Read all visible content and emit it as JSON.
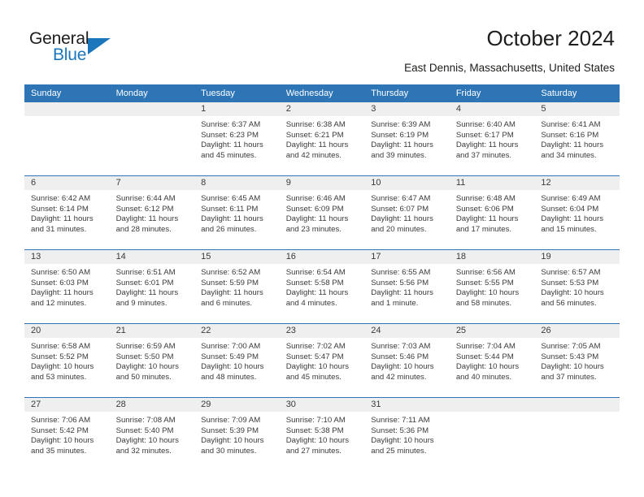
{
  "brand": {
    "name_part1": "General",
    "name_part2": "Blue",
    "icon": "triangle-logo-icon",
    "accent_color": "#1b76bc"
  },
  "header": {
    "title": "October 2024",
    "location": "East Dennis, Massachusetts, United States"
  },
  "colors": {
    "header_row_bg": "#2e75b6",
    "daynum_band_bg": "#efefef",
    "text": "#3a3a3a",
    "row_divider": "#2e75b6"
  },
  "calendar": {
    "weekday_headers": [
      "Sunday",
      "Monday",
      "Tuesday",
      "Wednesday",
      "Thursday",
      "Friday",
      "Saturday"
    ],
    "labels": {
      "sunrise_prefix": "Sunrise:",
      "sunset_prefix": "Sunset:",
      "daylight_prefix": "Daylight:"
    },
    "weeks": [
      [
        {
          "empty": true
        },
        {
          "empty": true
        },
        {
          "day": "1",
          "sunrise": "Sunrise: 6:37 AM",
          "sunset": "Sunset: 6:23 PM",
          "daylight_line1": "Daylight: 11 hours",
          "daylight_line2": "and 45 minutes."
        },
        {
          "day": "2",
          "sunrise": "Sunrise: 6:38 AM",
          "sunset": "Sunset: 6:21 PM",
          "daylight_line1": "Daylight: 11 hours",
          "daylight_line2": "and 42 minutes."
        },
        {
          "day": "3",
          "sunrise": "Sunrise: 6:39 AM",
          "sunset": "Sunset: 6:19 PM",
          "daylight_line1": "Daylight: 11 hours",
          "daylight_line2": "and 39 minutes."
        },
        {
          "day": "4",
          "sunrise": "Sunrise: 6:40 AM",
          "sunset": "Sunset: 6:17 PM",
          "daylight_line1": "Daylight: 11 hours",
          "daylight_line2": "and 37 minutes."
        },
        {
          "day": "5",
          "sunrise": "Sunrise: 6:41 AM",
          "sunset": "Sunset: 6:16 PM",
          "daylight_line1": "Daylight: 11 hours",
          "daylight_line2": "and 34 minutes."
        }
      ],
      [
        {
          "day": "6",
          "sunrise": "Sunrise: 6:42 AM",
          "sunset": "Sunset: 6:14 PM",
          "daylight_line1": "Daylight: 11 hours",
          "daylight_line2": "and 31 minutes."
        },
        {
          "day": "7",
          "sunrise": "Sunrise: 6:44 AM",
          "sunset": "Sunset: 6:12 PM",
          "daylight_line1": "Daylight: 11 hours",
          "daylight_line2": "and 28 minutes."
        },
        {
          "day": "8",
          "sunrise": "Sunrise: 6:45 AM",
          "sunset": "Sunset: 6:11 PM",
          "daylight_line1": "Daylight: 11 hours",
          "daylight_line2": "and 26 minutes."
        },
        {
          "day": "9",
          "sunrise": "Sunrise: 6:46 AM",
          "sunset": "Sunset: 6:09 PM",
          "daylight_line1": "Daylight: 11 hours",
          "daylight_line2": "and 23 minutes."
        },
        {
          "day": "10",
          "sunrise": "Sunrise: 6:47 AM",
          "sunset": "Sunset: 6:07 PM",
          "daylight_line1": "Daylight: 11 hours",
          "daylight_line2": "and 20 minutes."
        },
        {
          "day": "11",
          "sunrise": "Sunrise: 6:48 AM",
          "sunset": "Sunset: 6:06 PM",
          "daylight_line1": "Daylight: 11 hours",
          "daylight_line2": "and 17 minutes."
        },
        {
          "day": "12",
          "sunrise": "Sunrise: 6:49 AM",
          "sunset": "Sunset: 6:04 PM",
          "daylight_line1": "Daylight: 11 hours",
          "daylight_line2": "and 15 minutes."
        }
      ],
      [
        {
          "day": "13",
          "sunrise": "Sunrise: 6:50 AM",
          "sunset": "Sunset: 6:03 PM",
          "daylight_line1": "Daylight: 11 hours",
          "daylight_line2": "and 12 minutes."
        },
        {
          "day": "14",
          "sunrise": "Sunrise: 6:51 AM",
          "sunset": "Sunset: 6:01 PM",
          "daylight_line1": "Daylight: 11 hours",
          "daylight_line2": "and 9 minutes."
        },
        {
          "day": "15",
          "sunrise": "Sunrise: 6:52 AM",
          "sunset": "Sunset: 5:59 PM",
          "daylight_line1": "Daylight: 11 hours",
          "daylight_line2": "and 6 minutes."
        },
        {
          "day": "16",
          "sunrise": "Sunrise: 6:54 AM",
          "sunset": "Sunset: 5:58 PM",
          "daylight_line1": "Daylight: 11 hours",
          "daylight_line2": "and 4 minutes."
        },
        {
          "day": "17",
          "sunrise": "Sunrise: 6:55 AM",
          "sunset": "Sunset: 5:56 PM",
          "daylight_line1": "Daylight: 11 hours",
          "daylight_line2": "and 1 minute."
        },
        {
          "day": "18",
          "sunrise": "Sunrise: 6:56 AM",
          "sunset": "Sunset: 5:55 PM",
          "daylight_line1": "Daylight: 10 hours",
          "daylight_line2": "and 58 minutes."
        },
        {
          "day": "19",
          "sunrise": "Sunrise: 6:57 AM",
          "sunset": "Sunset: 5:53 PM",
          "daylight_line1": "Daylight: 10 hours",
          "daylight_line2": "and 56 minutes."
        }
      ],
      [
        {
          "day": "20",
          "sunrise": "Sunrise: 6:58 AM",
          "sunset": "Sunset: 5:52 PM",
          "daylight_line1": "Daylight: 10 hours",
          "daylight_line2": "and 53 minutes."
        },
        {
          "day": "21",
          "sunrise": "Sunrise: 6:59 AM",
          "sunset": "Sunset: 5:50 PM",
          "daylight_line1": "Daylight: 10 hours",
          "daylight_line2": "and 50 minutes."
        },
        {
          "day": "22",
          "sunrise": "Sunrise: 7:00 AM",
          "sunset": "Sunset: 5:49 PM",
          "daylight_line1": "Daylight: 10 hours",
          "daylight_line2": "and 48 minutes."
        },
        {
          "day": "23",
          "sunrise": "Sunrise: 7:02 AM",
          "sunset": "Sunset: 5:47 PM",
          "daylight_line1": "Daylight: 10 hours",
          "daylight_line2": "and 45 minutes."
        },
        {
          "day": "24",
          "sunrise": "Sunrise: 7:03 AM",
          "sunset": "Sunset: 5:46 PM",
          "daylight_line1": "Daylight: 10 hours",
          "daylight_line2": "and 42 minutes."
        },
        {
          "day": "25",
          "sunrise": "Sunrise: 7:04 AM",
          "sunset": "Sunset: 5:44 PM",
          "daylight_line1": "Daylight: 10 hours",
          "daylight_line2": "and 40 minutes."
        },
        {
          "day": "26",
          "sunrise": "Sunrise: 7:05 AM",
          "sunset": "Sunset: 5:43 PM",
          "daylight_line1": "Daylight: 10 hours",
          "daylight_line2": "and 37 minutes."
        }
      ],
      [
        {
          "day": "27",
          "sunrise": "Sunrise: 7:06 AM",
          "sunset": "Sunset: 5:42 PM",
          "daylight_line1": "Daylight: 10 hours",
          "daylight_line2": "and 35 minutes."
        },
        {
          "day": "28",
          "sunrise": "Sunrise: 7:08 AM",
          "sunset": "Sunset: 5:40 PM",
          "daylight_line1": "Daylight: 10 hours",
          "daylight_line2": "and 32 minutes."
        },
        {
          "day": "29",
          "sunrise": "Sunrise: 7:09 AM",
          "sunset": "Sunset: 5:39 PM",
          "daylight_line1": "Daylight: 10 hours",
          "daylight_line2": "and 30 minutes."
        },
        {
          "day": "30",
          "sunrise": "Sunrise: 7:10 AM",
          "sunset": "Sunset: 5:38 PM",
          "daylight_line1": "Daylight: 10 hours",
          "daylight_line2": "and 27 minutes."
        },
        {
          "day": "31",
          "sunrise": "Sunrise: 7:11 AM",
          "sunset": "Sunset: 5:36 PM",
          "daylight_line1": "Daylight: 10 hours",
          "daylight_line2": "and 25 minutes."
        },
        {
          "empty": true
        },
        {
          "empty": true
        }
      ]
    ]
  }
}
